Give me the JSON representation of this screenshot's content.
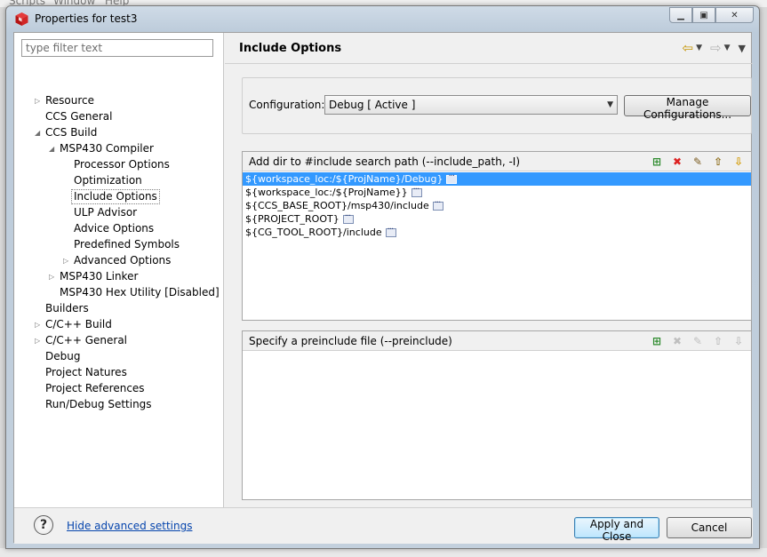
{
  "background": {
    "menu_items": [
      "Scripts",
      "Window",
      "Help"
    ]
  },
  "window": {
    "title": "Properties for test3",
    "icon": "ccs-cube-icon",
    "controls": [
      "minimize-icon",
      "maximize-icon",
      "close-icon"
    ]
  },
  "filter": {
    "placeholder": "type filter text"
  },
  "tree": [
    {
      "label": "Resource",
      "twisty": "collapsed"
    },
    {
      "label": "CCS General"
    },
    {
      "label": "CCS Build",
      "twisty": "expanded"
    },
    {
      "label": "MSP430 Compiler",
      "twisty": "expanded"
    },
    {
      "label": "Processor Options"
    },
    {
      "label": "Optimization"
    },
    {
      "label": "Include Options",
      "selected": true
    },
    {
      "label": "ULP Advisor"
    },
    {
      "label": "Advice Options"
    },
    {
      "label": "Predefined Symbols"
    },
    {
      "label": "Advanced Options",
      "twisty": "collapsed"
    },
    {
      "label": "MSP430 Linker",
      "twisty": "collapsed"
    },
    {
      "label": "MSP430 Hex Utility  [Disabled]"
    },
    {
      "label": "Builders"
    },
    {
      "label": "C/C++ Build",
      "twisty": "collapsed"
    },
    {
      "label": "C/C++ General",
      "twisty": "collapsed"
    },
    {
      "label": "Debug"
    },
    {
      "label": "Project Natures"
    },
    {
      "label": "Project References"
    },
    {
      "label": "Run/Debug Settings"
    }
  ],
  "page": {
    "title": "Include Options",
    "nav_icons": [
      "back-arrow-icon",
      "forward-arrow-icon",
      "view-menu-icon"
    ]
  },
  "configuration": {
    "label": "Configuration:",
    "selected": "Debug  [ Active ]",
    "manage_label": "Manage Configurations..."
  },
  "include_paths": {
    "title": "Add dir to #include search path (--include_path, -I)",
    "tools": [
      "add-icon",
      "delete-icon",
      "edit-icon",
      "move-up-icon",
      "move-down-icon"
    ],
    "items": [
      "${workspace_loc:/${ProjName}/Debug}",
      "${workspace_loc:/${ProjName}}",
      "${CCS_BASE_ROOT}/msp430/include",
      "${PROJECT_ROOT}",
      "${CG_TOOL_ROOT}/include"
    ],
    "selected_index": 0
  },
  "preinclude": {
    "title": "Specify a preinclude file (--preinclude)",
    "tools": [
      "add-icon",
      "delete-icon",
      "edit-icon",
      "move-up-icon",
      "move-down-icon"
    ],
    "items": []
  },
  "footer": {
    "help_icon": "help-icon",
    "advanced_link": "Hide advanced settings",
    "apply_label": "Apply and Close",
    "cancel_label": "Cancel"
  }
}
